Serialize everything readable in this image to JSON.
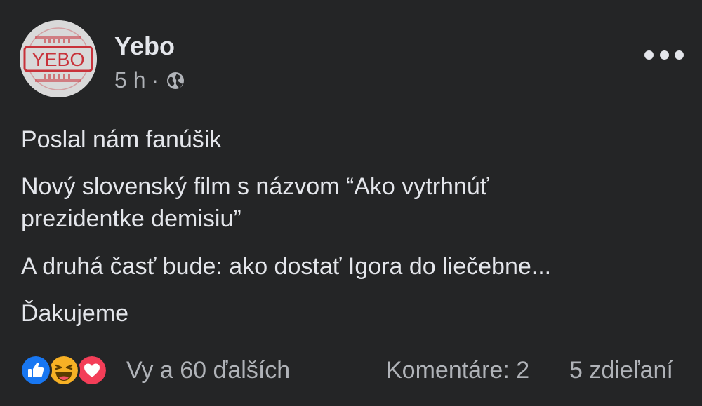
{
  "post": {
    "page_name": "Yebo",
    "avatar_logo_text": "YEBO",
    "time": "5 h",
    "separator": "·",
    "privacy_icon": "globe-icon",
    "more_icon": "more-horizontal-icon",
    "paragraphs": [
      "Poslal nám fanúšik",
      "Nový slovenský film s názvom “Ako vytrhnúť prezidentke demisiu”",
      "A druhá časť bude: ako dostať Igora do liečebne...",
      "Ďakujeme"
    ]
  },
  "footer": {
    "reaction_icons": [
      "like-icon",
      "haha-icon",
      "love-icon"
    ],
    "reactions_text": "Vy a 60 ďalších",
    "comments_text": "Komentáre: 2",
    "shares_text": "5 zdieľaní"
  },
  "colors": {
    "background": "#242526",
    "primary_text": "#e4e6eb",
    "secondary_text": "#b0b3b8",
    "like_blue": "#1877f2",
    "love_red": "#f33e58",
    "haha_yellow": "#f7b125",
    "logo_red": "#c8323a"
  }
}
